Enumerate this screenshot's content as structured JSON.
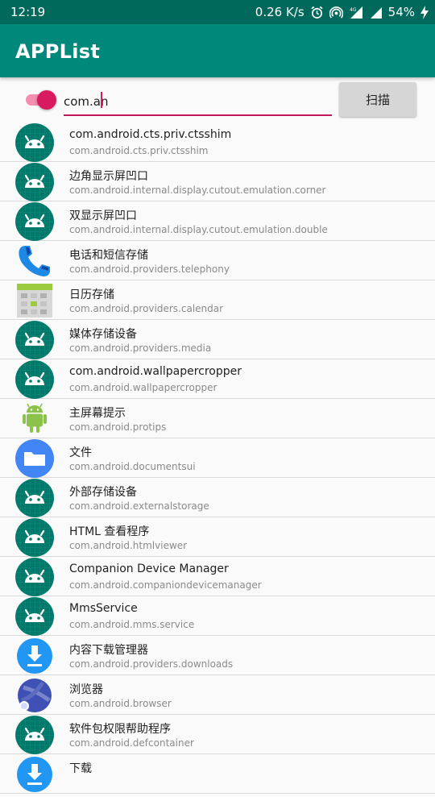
{
  "status_bar": {
    "time": "12:19",
    "speed": "0.26 K/s",
    "battery": "54%"
  },
  "app_bar": {
    "title": "APPList"
  },
  "controls": {
    "filter_enabled": true,
    "search_value": "com.an",
    "scan_label": "扫描"
  },
  "apps": [
    {
      "label": "com.android.cts.priv.ctsshim",
      "package": "com.android.cts.priv.ctsshim",
      "icon": "android-robot-icon"
    },
    {
      "label": "边角显示屏凹口",
      "package": "com.android.internal.display.cutout.emulation.corner",
      "icon": "android-robot-icon"
    },
    {
      "label": "双显示屏凹口",
      "package": "com.android.internal.display.cutout.emulation.double",
      "icon": "android-robot-icon"
    },
    {
      "label": "电话和短信存储",
      "package": "com.android.providers.telephony",
      "icon": "phone-handset-icon"
    },
    {
      "label": "日历存储",
      "package": "com.android.providers.calendar",
      "icon": "calendar-storage-icon"
    },
    {
      "label": "媒体存储设备",
      "package": "com.android.providers.media",
      "icon": "android-robot-icon"
    },
    {
      "label": "com.android.wallpapercropper",
      "package": "com.android.wallpapercropper",
      "icon": "android-robot-icon"
    },
    {
      "label": "主屏幕提示",
      "package": "com.android.protips",
      "icon": "green-android-icon"
    },
    {
      "label": "文件",
      "package": "com.android.documentsui",
      "icon": "folder-icon"
    },
    {
      "label": "外部存储设备",
      "package": "com.android.externalstorage",
      "icon": "android-robot-icon"
    },
    {
      "label": "HTML 查看程序",
      "package": "com.android.htmlviewer",
      "icon": "android-robot-icon"
    },
    {
      "label": "Companion Device Manager",
      "package": "com.android.companiondevicemanager",
      "icon": "android-robot-icon"
    },
    {
      "label": "MmsService",
      "package": "com.android.mms.service",
      "icon": "android-robot-icon"
    },
    {
      "label": "内容下载管理器",
      "package": "com.android.providers.downloads",
      "icon": "download-icon"
    },
    {
      "label": "浏览器",
      "package": "com.android.browser",
      "icon": "browser-globe-icon"
    },
    {
      "label": "软件包权限帮助程序",
      "package": "com.android.defcontainer",
      "icon": "android-robot-icon"
    },
    {
      "label": "下载",
      "package": "",
      "icon": "download-icon"
    }
  ],
  "colors": {
    "status_bar": "#00695c",
    "app_bar": "#00897b",
    "accent": "#d81b60"
  }
}
